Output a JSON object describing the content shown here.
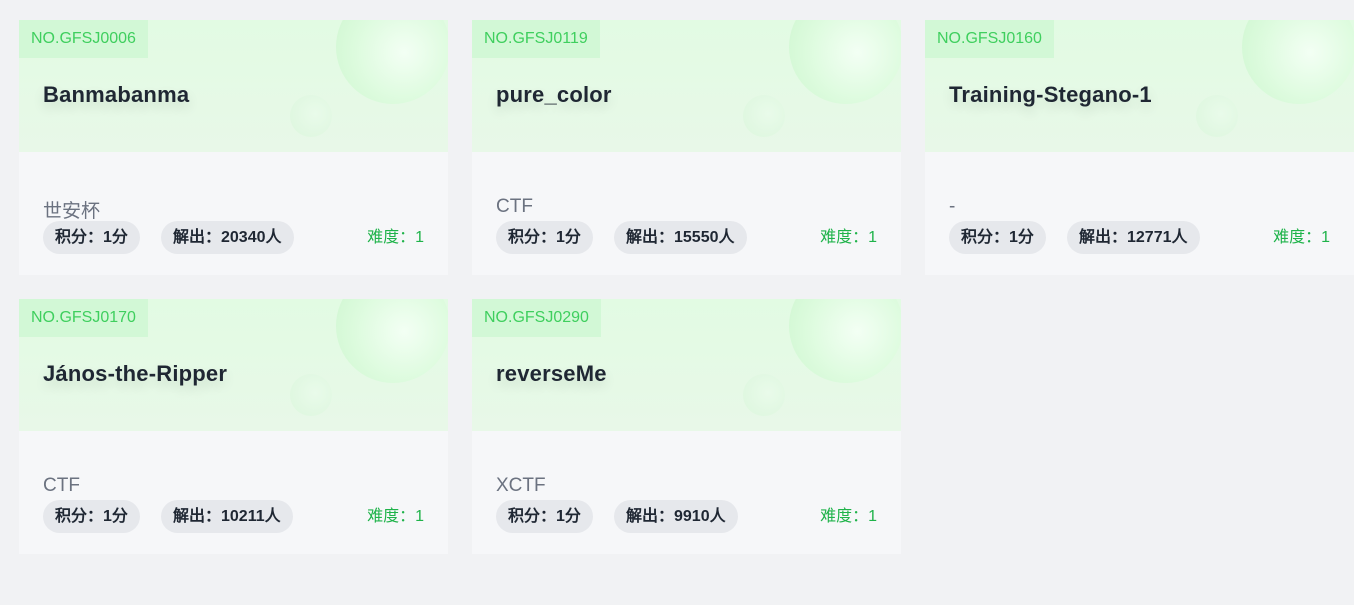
{
  "challenges": [
    {
      "no": "NO.GFSJ0006",
      "title": "Banmabanma",
      "source": "世安杯",
      "score": "积分：1分",
      "solved": "解出：20340人",
      "difficulty": "难度：1"
    },
    {
      "no": "NO.GFSJ0119",
      "title": "pure_color",
      "source": "CTF",
      "score": "积分：1分",
      "solved": "解出：15550人",
      "difficulty": "难度：1"
    },
    {
      "no": "NO.GFSJ0160",
      "title": "Training-Stegano-1",
      "source": "-",
      "score": "积分：1分",
      "solved": "解出：12771人",
      "difficulty": "难度：1"
    },
    {
      "no": "NO.GFSJ0170",
      "title": "János-the-Ripper",
      "source": "CTF",
      "score": "积分：1分",
      "solved": "解出：10211人",
      "difficulty": "难度：1"
    },
    {
      "no": "NO.GFSJ0290",
      "title": "reverseMe",
      "source": "XCTF",
      "score": "积分：1分",
      "solved": "解出：9910人",
      "difficulty": "难度：1"
    }
  ],
  "colors": {
    "accent_green": "#3fcf5e",
    "difficulty_green": "#1fb34a",
    "header_tint": "#e2fbe3",
    "page_bg": "#f1f2f4"
  }
}
